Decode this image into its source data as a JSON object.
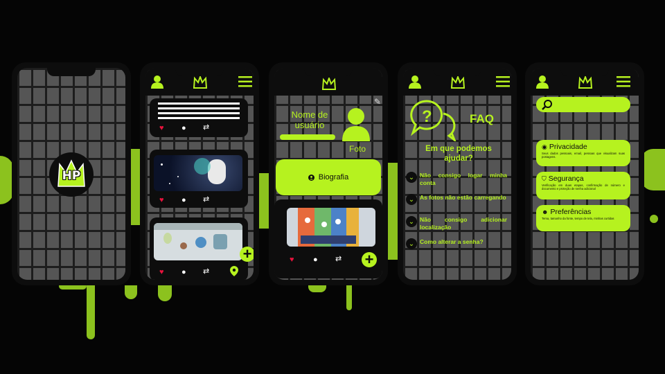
{
  "colors": {
    "accent": "#b6f21f",
    "dark": "#0d0d0d",
    "like": "#e8133d",
    "brick": "#555555"
  },
  "splash": {
    "logo_text": "HP"
  },
  "feed": {
    "icons": [
      "user-icon",
      "crown-logo-icon",
      "menu-icon",
      "heart-icon",
      "comment-icon",
      "repost-icon",
      "location-pin-icon",
      "plus-icon"
    ]
  },
  "profile": {
    "name_label": "Nome de usuário",
    "photo_label": "Foto",
    "bio_label": "Biografia"
  },
  "faq": {
    "title": "FAQ",
    "subtitle": "Em que podemos ajudar?",
    "items": [
      {
        "label": "Não consigo logar minha conta"
      },
      {
        "label": "As fotos não estão carregando"
      },
      {
        "label": "Não consigo adicionar localização"
      },
      {
        "label": "Como alterar a senha?"
      }
    ]
  },
  "settings": {
    "search": {
      "placeholder": ""
    },
    "cards": [
      {
        "title": "Privacidade",
        "desc": "Seus dados pessoais, email, pessoas que visualizam suas postagens."
      },
      {
        "title": "Segurança",
        "desc": "Verificação em duas etapas, confirmação de número e documento e proteção de senha adicional"
      },
      {
        "title": "Preferências",
        "desc": "Tema, tamanho da fonte, tempo de tela, minhas curtidas"
      }
    ]
  }
}
